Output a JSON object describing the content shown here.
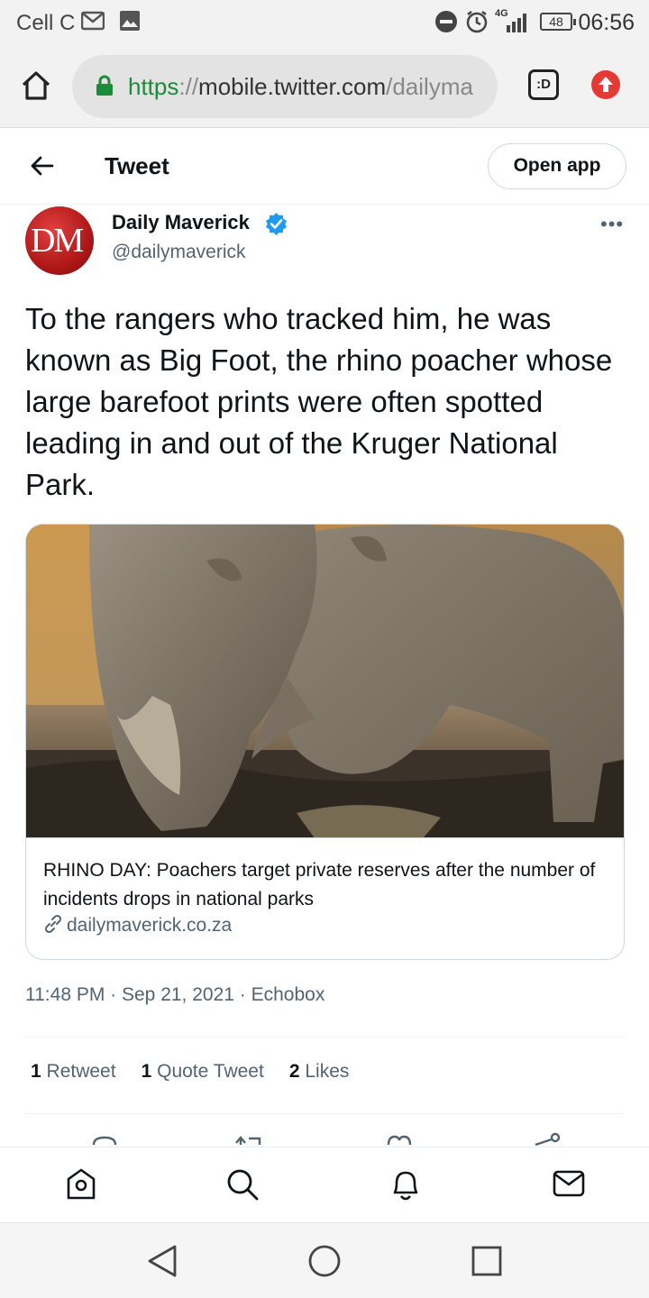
{
  "status_bar": {
    "carrier": "Cell C",
    "network": "4G",
    "battery": "48",
    "time": "06:56"
  },
  "browser": {
    "url_scheme": "https",
    "url_separator": "://",
    "url_host": "mobile.twitter.com",
    "url_path": "/dailyma",
    "tabs_label": ":D"
  },
  "header": {
    "title": "Tweet",
    "open_app": "Open app"
  },
  "author": {
    "avatar_text": "DM",
    "name": "Daily Maverick",
    "handle": "@dailymaverick",
    "verified": true
  },
  "more_menu": "•••",
  "tweet": {
    "text": "To the rangers who tracked him, he was known as Big Foot, the rhino poacher whose large barefoot prints were often spotted leading in and out of the Kruger National Park."
  },
  "card": {
    "title": "RHINO DAY: Poachers target private reserves after the number of incidents drops in national parks",
    "domain": "dailymaverick.co.za"
  },
  "meta": {
    "timestamp": "11:48 PM · Sep 21, 2021 · Echobox"
  },
  "stats": {
    "retweets_count": "1",
    "retweets_label": "Retweet",
    "quotes_count": "1",
    "quotes_label": "Quote Tweet",
    "likes_count": "2",
    "likes_label": "Likes"
  },
  "colors": {
    "twitter_blue": "#1d9bf0",
    "secure_green": "#1a8c3c",
    "update_red": "#e53935",
    "avatar_red": "#b01818",
    "muted_text": "#536471"
  },
  "icons": {
    "nav": [
      "home-icon",
      "search-icon",
      "notifications-icon",
      "messages-icon"
    ],
    "system": [
      "back-triangle-icon",
      "home-circle-icon",
      "recents-square-icon"
    ]
  }
}
